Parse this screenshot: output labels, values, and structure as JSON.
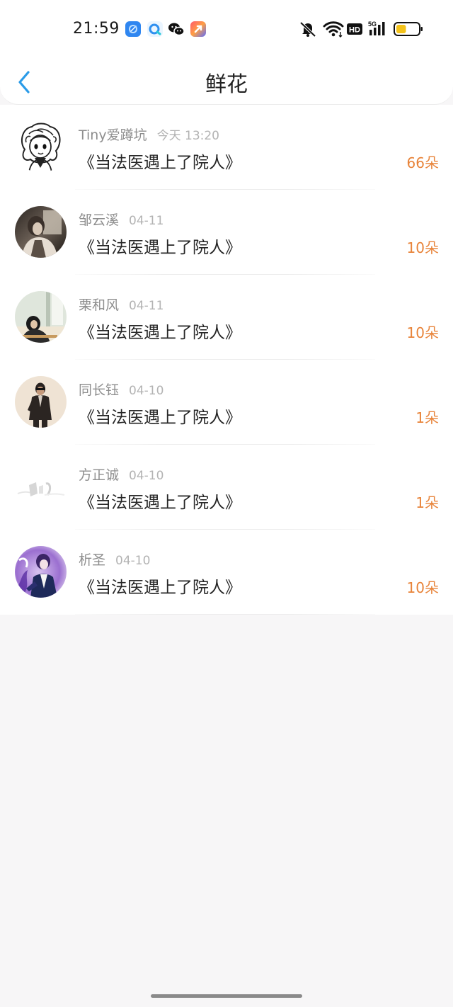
{
  "status_bar": {
    "time": "21:59",
    "app_icons": [
      "browser-icon",
      "search-app-icon",
      "wechat-icon",
      "app-shortcut-icon"
    ],
    "system_icons": [
      "mute-icon",
      "wifi-icon",
      "hd-icon",
      "signal-5g-icon",
      "battery-icon"
    ],
    "hd_label": "HD",
    "network_label": "5G",
    "battery_level": 0.45
  },
  "header": {
    "title": "鲜花",
    "back_icon": "chevron-left-icon"
  },
  "colors": {
    "accent": "#2a9be8",
    "count": "#e8843a",
    "title": "#222222"
  },
  "records": [
    {
      "user": "Tiny爱蹲坑",
      "date": "今天 13:20",
      "book": "《当法医遇上了院人》",
      "count": "66朵"
    },
    {
      "user": "邹云溪",
      "date": "04-11",
      "book": "《当法医遇上了院人》",
      "count": "10朵"
    },
    {
      "user": "栗和风",
      "date": "04-11",
      "book": "《当法医遇上了院人》",
      "count": "10朵"
    },
    {
      "user": "同长钰",
      "date": "04-10",
      "book": "《当法医遇上了院人》",
      "count": "1朵"
    },
    {
      "user": "方正诚",
      "date": "04-10",
      "book": "《当法医遇上了院人》",
      "count": "1朵"
    },
    {
      "user": "析圣",
      "date": "04-10",
      "book": "《当法医遇上了院人》",
      "count": "10朵"
    }
  ]
}
